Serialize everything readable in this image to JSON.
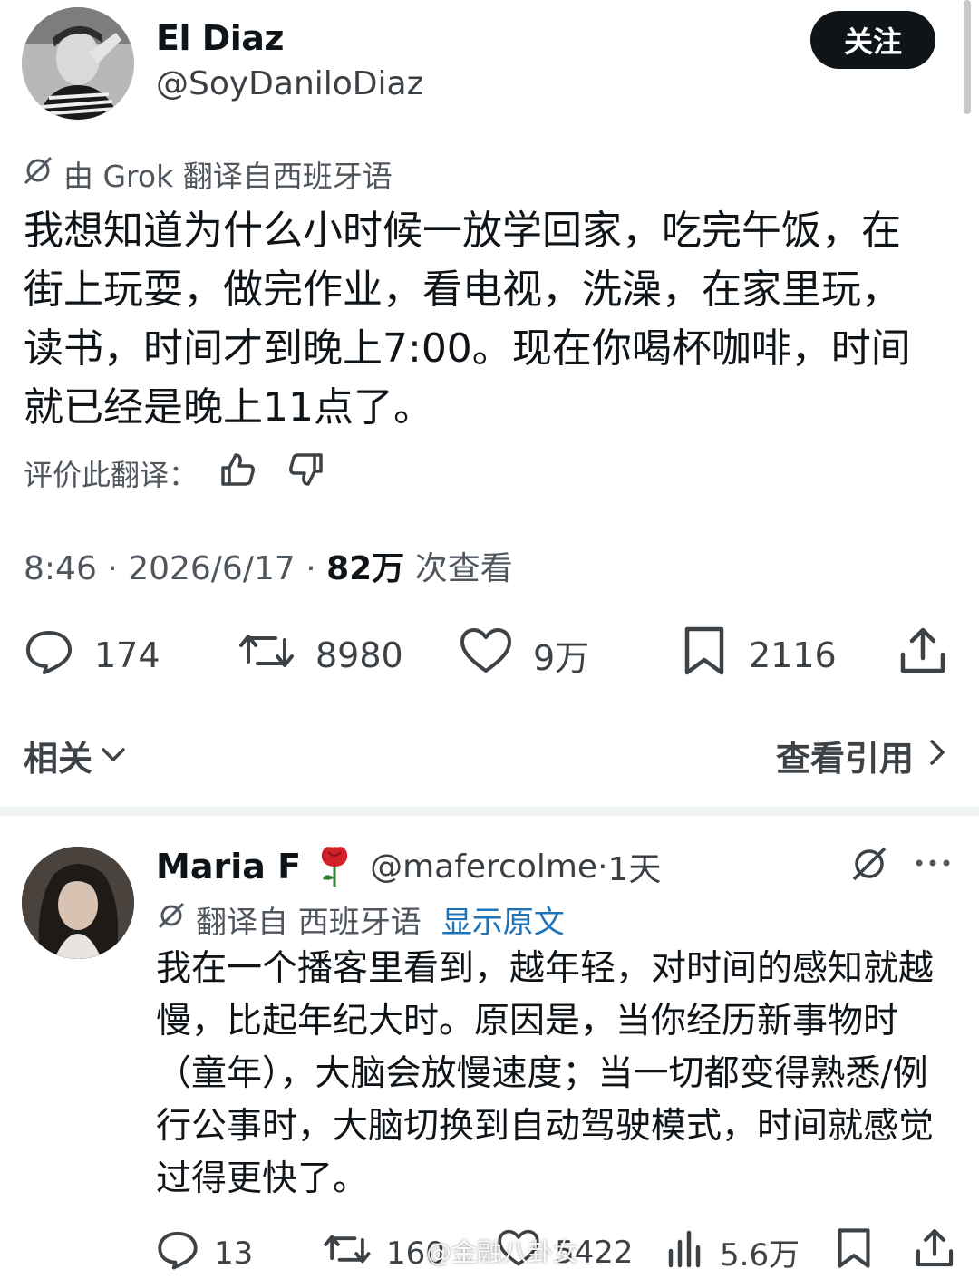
{
  "tweet": {
    "author_name": "El Diaz",
    "author_handle": "@SoyDaniloDiaz",
    "follow_label": "关注",
    "translated_notice": "由 Grok 翻译自西班牙语",
    "text": "我想知道为什么小时候一放学回家，吃完午饭，在街上玩耍，做完作业，看电视，洗澡，在家里玩，读书，时间才到晚上7:00。现在你喝杯咖啡，时间就已经是晚上11点了。",
    "rate_label": "评价此翻译：",
    "time": "8:46",
    "date": "2026/6/17",
    "views_count": "82万",
    "views_label": "次查看",
    "replies": "174",
    "reposts": "8980",
    "likes": "9万",
    "bookmarks": "2116"
  },
  "nav": {
    "related_label": "相关",
    "quotes_label": "查看引用"
  },
  "reply": {
    "author_name": "Maria F",
    "author_handle": "@mafercolme",
    "age": "1天",
    "translated_label": "翻译自 西班牙语",
    "show_original": "显示原文",
    "text": "我在一个播客里看到，越年轻，对时间的感知就越慢，比起年纪大时。原因是，当你经历新事物时（童年），大脑会放慢速度；当一切都变得熟悉/例行公事时，大脑切换到自动驾驶模式，时间就感觉过得更快了。",
    "replies": "13",
    "reposts": "160",
    "likes": "5422",
    "views": "5.6万"
  },
  "watermark": "@金融八卦女",
  "colors": {
    "text": "#0f1419",
    "muted": "#50565d",
    "link": "#1d72b8",
    "divider": "#eff3f4",
    "rose": "#d2202a"
  }
}
